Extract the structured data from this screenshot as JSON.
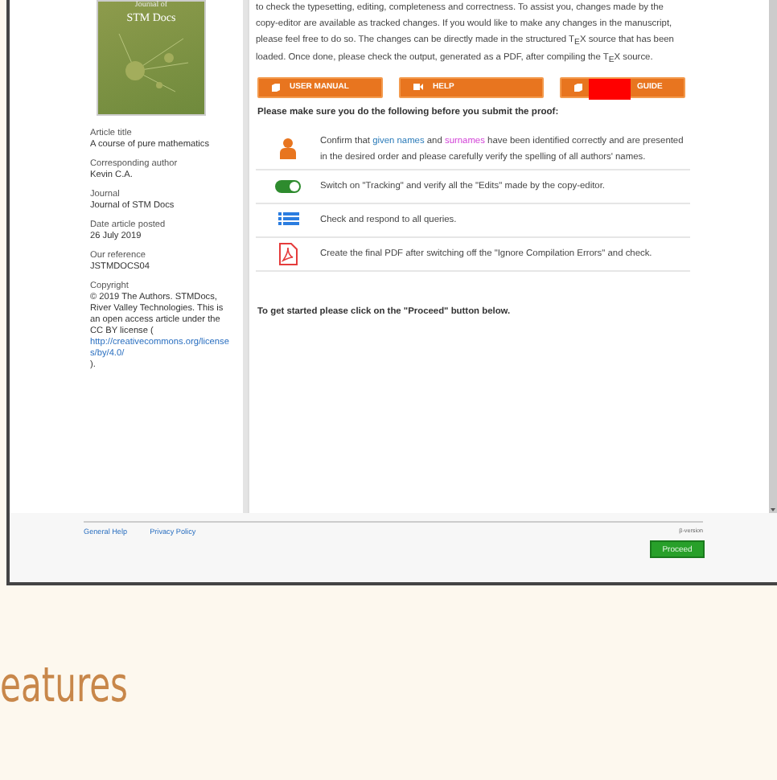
{
  "cover": {
    "title": "STM Docs",
    "subtitle": "Journal of"
  },
  "sidebar": {
    "fields": [
      {
        "label": "Article title",
        "value": "A course of pure mathematics"
      },
      {
        "label": "Corresponding author",
        "value": "Kevin C.A."
      },
      {
        "label": "Journal",
        "value": "Journal of STM Docs"
      },
      {
        "label": "Date article posted",
        "value": "26 July 2019"
      },
      {
        "label": "Our reference",
        "value": "JSTMDOCS04"
      },
      {
        "label": "Copyright",
        "value": "© 2019 The Authors. STMDocs, River Valley Technologies. This is an open access article under the CC BY license (",
        "link": "http://creativecommons.org/licenses/by/4.0/",
        "value_end": ")."
      }
    ]
  },
  "intro": "to check the typesetting, editing, completeness and correctness. To assist you, changes made by the copy-editor are available as tracked changes. If you would like to make any changes in the manuscript, please feel free to do so. The changes can be directly made in the structured T$_{E}$X source that has been loaded. Once done, please check the output, generated as a PDF, after compiling the T$_{E}$X source.",
  "buttons": [
    {
      "label": "USER MANUAL",
      "kind": "book",
      "redacted": false
    },
    {
      "label": "HELP",
      "kind": "video",
      "redacted": false
    },
    {
      "label": "GUIDE",
      "kind": "book",
      "redacted": true
    }
  ],
  "checklist_heading": "Please make sure you do the following before you submit the proof:",
  "checklist": [
    {
      "kind": "person",
      "segments": [
        {
          "text": "Confirm that "
        },
        {
          "text": "given names",
          "color": "#2b7bb9"
        },
        {
          "text": " and "
        },
        {
          "text": "surnames",
          "color": "#d13fd6"
        },
        {
          "text": " have been identified correctly and are presented in the desired order and please carefully verify the spelling of all authors' names."
        }
      ]
    },
    {
      "kind": "toggle",
      "segments": [
        {
          "text": "Switch on \"Tracking\" and verify all the \"Edits\" made by the copy-editor."
        }
      ]
    },
    {
      "kind": "list",
      "segments": [
        {
          "text": "Check and respond to all queries."
        }
      ]
    },
    {
      "kind": "pdf",
      "segments": [
        {
          "text": "Create the final PDF after switching off the \"Ignore Compilation Errors\" and check."
        }
      ]
    }
  ],
  "get_started": "To get started please click on the \"Proceed\" button below.",
  "footer": {
    "links": [
      "General Help",
      "Privacy Policy"
    ],
    "version": "β-version",
    "proceed": "Proceed"
  },
  "section_heading": "eatures"
}
